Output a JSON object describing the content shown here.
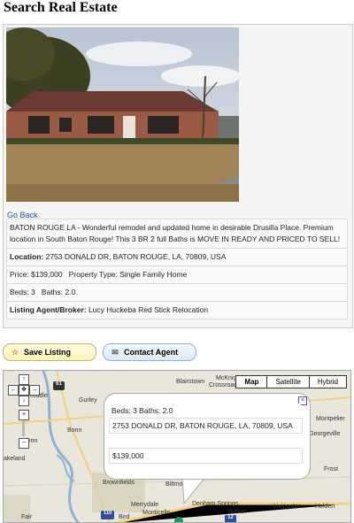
{
  "page": {
    "title": "Search Real Estate"
  },
  "listing": {
    "go_back": "Go Back",
    "description": "BATON ROUGE LA - Wonderful remodel and updated home in desirable Drusilla Place. Premium location in South Baton Rouge! This 3 BR 2 full Baths is MOVE IN READY AND PRICED TO SELL!",
    "location_label": "Location:",
    "location": "2753 DONALD DR, BATON ROUGE, LA, 70809, USA",
    "price_text": "Price: $139,000",
    "property_type_text": "Property Type: Single Family Home",
    "beds_text": "Beds: 3",
    "baths_text": "Baths: 2.0",
    "agent_label": "Listing Agent/Broker:",
    "agent": "Lucy Huckeba Red Stick Relocation"
  },
  "actions": {
    "save_label": "Save Listing",
    "contact_label": "Contact Agent"
  },
  "map": {
    "types": [
      "Map",
      "Satellite",
      "Hybrid"
    ],
    "selected_type": "Map",
    "bubble": {
      "beds_baths": "Beds: 3  Baths: 2.0",
      "address": "2753 DONALD DR, BATON ROUGE, LA, 70809, USA",
      "price": "$139,000"
    },
    "labels": {
      "l1": "McKnight",
      "l2": "Crossroads",
      "l3": "Blairstown",
      "l4": "Riddle",
      "l5": "Gurley",
      "l6": "Bonn",
      "l7": "Glynn",
      "l8": "akeland",
      "l9": "Montpelier",
      "l10": "Georgeville",
      "l11": "Frost",
      "l12": "Brownfields",
      "l13": "Biltmore",
      "l14": "Merrydale",
      "l15": "Denham Springs",
      "l16": "Monticello",
      "l17": "Livingston",
      "l18": "Holden",
      "l19": "Walker",
      "l20": "Bird",
      "l21": "Fair"
    },
    "shields": {
      "s1": "61",
      "s2": "110",
      "s3": "12"
    },
    "controls": {
      "up": "↑",
      "left": "←",
      "center": "✥",
      "right": "→",
      "down": "↓",
      "zoom_in": "+",
      "zoom_out": "−"
    }
  }
}
